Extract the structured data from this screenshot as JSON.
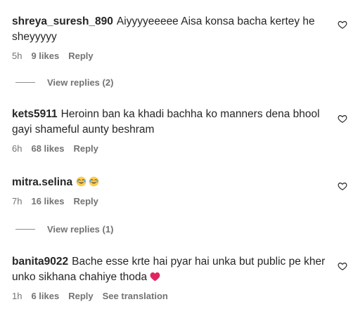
{
  "comments": [
    {
      "username": "shreya_suresh_890",
      "text": "Aiyyyyeeeee Aisa konsa bacha kertey he sheyyyyy",
      "time": "5h",
      "likes": "9 likes",
      "reply": "Reply",
      "view_replies": "View replies (2)"
    },
    {
      "username": "kets5911",
      "text": "Heroinn ban ka khadi bachha ko manners dena bhool gayi shameful aunty beshram",
      "time": "6h",
      "likes": "68 likes",
      "reply": "Reply"
    },
    {
      "username": "mitra.selina",
      "text": "",
      "emojis": [
        "laughing-emoji",
        "laughing-emoji"
      ],
      "time": "7h",
      "likes": "16 likes",
      "reply": "Reply",
      "view_replies": "View replies (1)"
    },
    {
      "username": "banita9022",
      "text": "Bache esse krte hai pyar hai unka but public pe kher unko sikhana chahiye thoda",
      "trailing_icon": "red-heart-emoji",
      "time": "1h",
      "likes": "6 likes",
      "reply": "Reply",
      "see_translation": "See translation"
    }
  ],
  "colors": {
    "text": "#262626",
    "meta": "#737373",
    "heart_red": "#e0245e",
    "emoji_yellow": "#ffcc4d"
  }
}
